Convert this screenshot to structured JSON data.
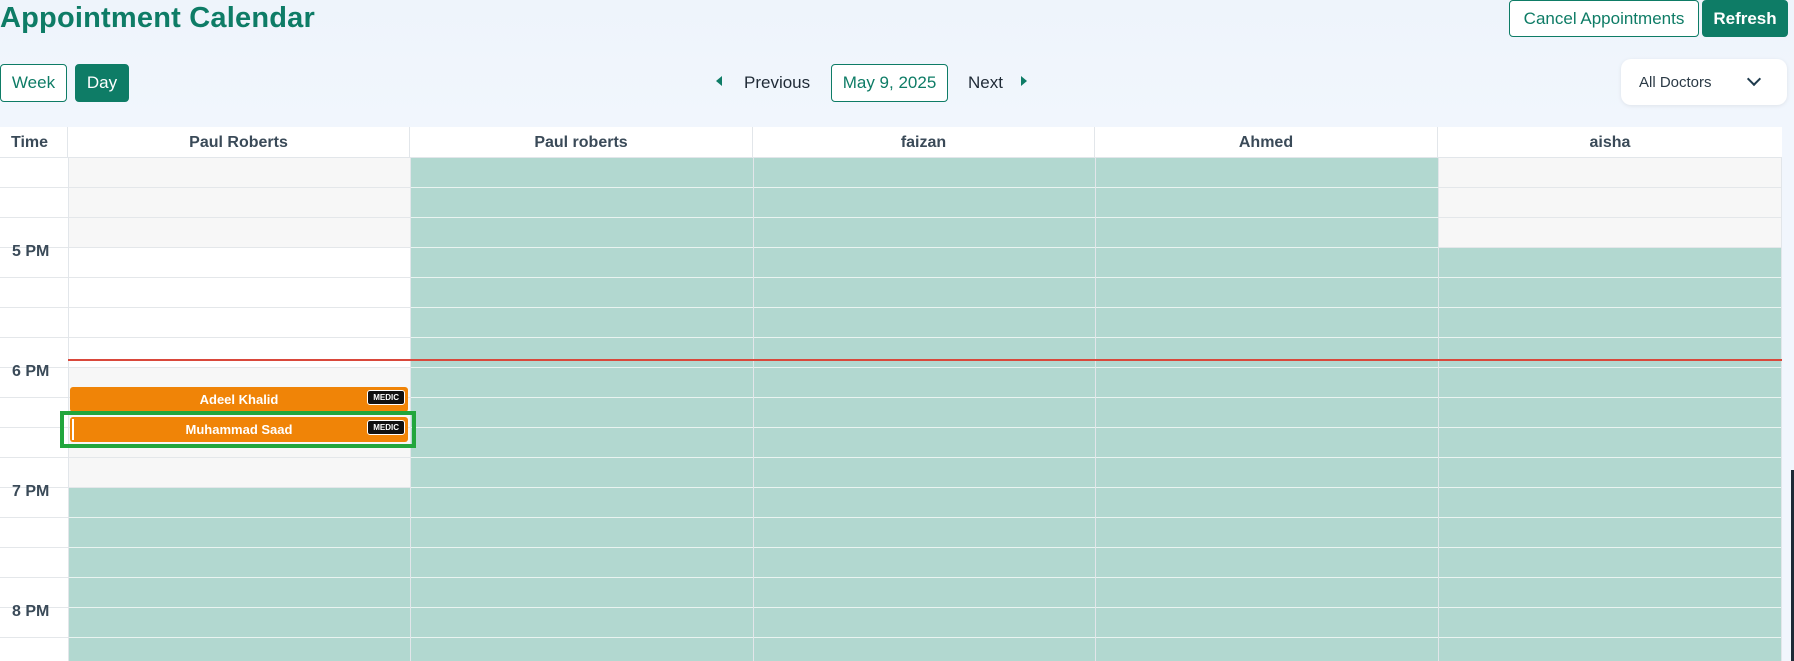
{
  "header": {
    "title": "Appointment Calendar",
    "cancel_label": "Cancel Appointments",
    "refresh_label": "Refresh"
  },
  "toolbar": {
    "week_label": "Week",
    "day_label": "Day",
    "active_view": "Day",
    "previous_label": "Previous",
    "next_label": "Next",
    "date_label": "May 9, 2025",
    "doctor_filter": "All Doctors"
  },
  "calendar": {
    "time_header": "Time",
    "columns": [
      "Paul Roberts",
      "Paul roberts",
      "faizan",
      "Ahmed",
      "aisha"
    ],
    "time_labels": [
      "5 PM",
      "6 PM",
      "7 PM",
      "8 PM"
    ],
    "appointments": [
      {
        "patient": "Adeel Khalid",
        "badge": "MEDIC"
      },
      {
        "patient": "Muhammad Saad",
        "badge": "MEDIC"
      }
    ]
  },
  "colors": {
    "brand": "#0e7c66",
    "unavailable_slot": "#b2d8d0",
    "appointment": "#f08407",
    "now_line": "#d9483b",
    "selection_box": "#22a63c"
  }
}
